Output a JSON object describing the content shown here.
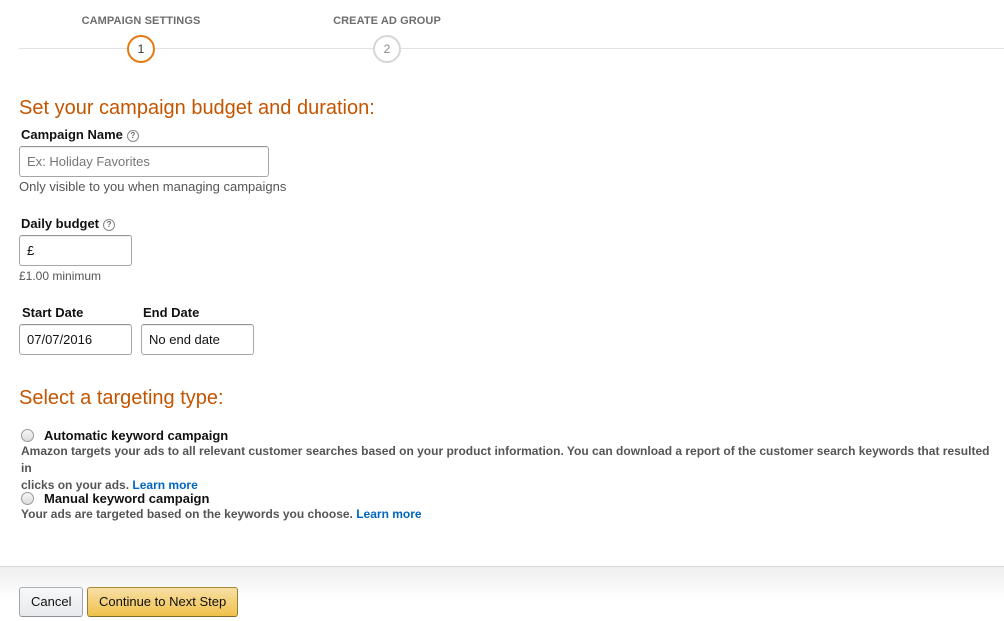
{
  "stepper": {
    "steps": [
      {
        "label": "CAMPAIGN SETTINGS",
        "number": "1",
        "state": "active"
      },
      {
        "label": "CREATE AD GROUP",
        "number": "2",
        "state": "inactive"
      }
    ],
    "active_color": "#e47911"
  },
  "budget_section": {
    "heading": "Set your campaign budget and duration:",
    "campaign_name": {
      "label": "Campaign Name",
      "help_icon": "question-circle-icon",
      "value": "",
      "placeholder": "Ex: Holiday Favorites",
      "hint": "Only visible to you when managing campaigns"
    },
    "daily_budget": {
      "label": "Daily budget",
      "help_icon": "question-circle-icon",
      "value": "£",
      "hint": "£1.00 minimum"
    },
    "start_date": {
      "label": "Start Date",
      "value": "07/07/2016"
    },
    "end_date": {
      "label": "End Date",
      "value": "No end date"
    }
  },
  "targeting_section": {
    "heading": "Select a targeting type:",
    "options": [
      {
        "label": "Automatic keyword campaign",
        "selected": false,
        "description_line1": "Amazon targets your ads to all relevant customer searches based on your product information. You can download a report of the customer search keywords that resulted in",
        "description_line2": "clicks on your ads.",
        "link": "Learn more"
      },
      {
        "label": "Manual keyword campaign",
        "selected": false,
        "description_line1": "Your ads are targeted based on the keywords you choose.",
        "link": "Learn more"
      }
    ]
  },
  "footer": {
    "cancel_label": "Cancel",
    "continue_label": "Continue to Next Step"
  },
  "colors": {
    "heading": "#c45500",
    "link": "#0066c0",
    "primary_button": "#f0c14b"
  }
}
